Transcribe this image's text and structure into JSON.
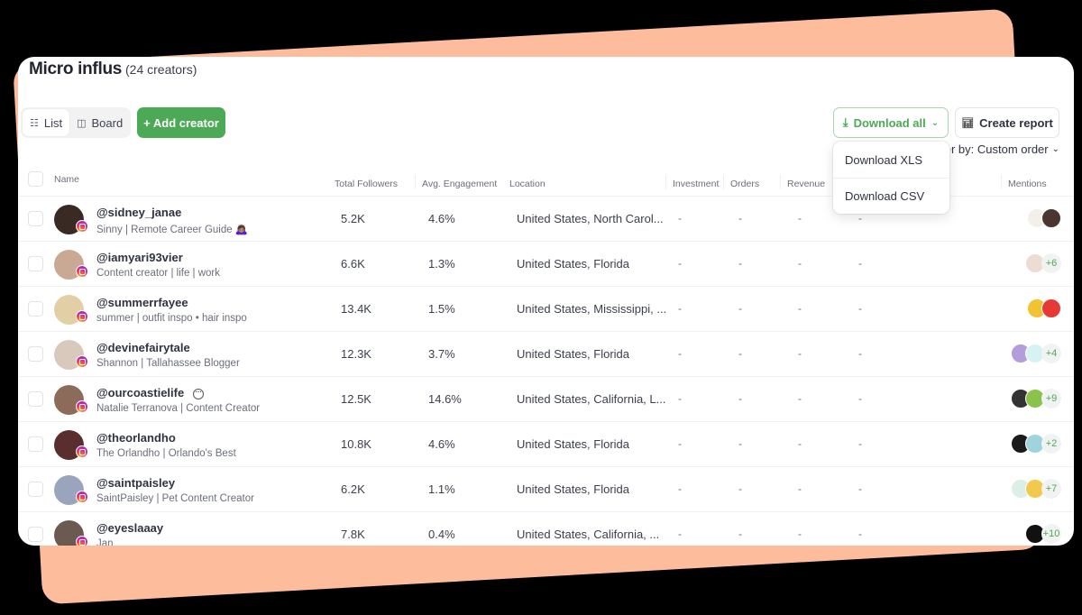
{
  "header": {
    "title": "Micro influs",
    "subtitle": "(24 creators)"
  },
  "toolbar": {
    "view_list": "List",
    "view_board": "Board",
    "add_creator": "+ Add creator",
    "download_all": "Download all",
    "create_report": "Create report",
    "order_by": "Order by: Custom order"
  },
  "dropdown": {
    "items": [
      "Download XLS",
      "Download CSV"
    ]
  },
  "table": {
    "columns": {
      "name": "Name",
      "followers": "Total Followers",
      "engagement": "Avg. Engagement",
      "location": "Location",
      "investment": "Investment",
      "orders": "Orders",
      "revenue": "Revenue",
      "mentions": "Mentions"
    },
    "rows": [
      {
        "handle": "@sidney_janae",
        "bio": "Sinny | Remote Career Guide 🙇🏽‍♀️",
        "followers": "5.2K",
        "engagement": "4.6%",
        "location": "United States, North Carol...",
        "investment": "-",
        "orders": "-",
        "revenue": "-",
        "extra": "-",
        "mentions_more": "",
        "avatar_color": "#3a2a24",
        "mention_colors": [
          "#f3efe9",
          "#4a3530"
        ]
      },
      {
        "handle": "@iamyari93vier",
        "bio": "Content creator | life | work",
        "followers": "6.6K",
        "engagement": "1.3%",
        "location": "United States, Florida",
        "investment": "-",
        "orders": "-",
        "revenue": "-",
        "extra": "-",
        "mentions_more": "+6",
        "avatar_color": "#c9a994",
        "mention_colors": [
          "#eddcd3"
        ]
      },
      {
        "handle": "@summerrfayee",
        "bio": "summer | outfit inspo • hair inspo",
        "followers": "13.4K",
        "engagement": "1.5%",
        "location": "United States, Mississippi, ...",
        "investment": "-",
        "orders": "-",
        "revenue": "-",
        "extra": "-",
        "mentions_more": "",
        "avatar_color": "#e3cfa6",
        "mention_colors": [
          "#f1c232",
          "#e53935"
        ]
      },
      {
        "handle": "@devinefairytale",
        "bio": "Shannon | Tallahassee Blogger",
        "followers": "12.3K",
        "engagement": "3.7%",
        "location": "United States, Florida",
        "investment": "-",
        "orders": "-",
        "revenue": "-",
        "extra": "-",
        "mentions_more": "+4",
        "avatar_color": "#d9c8bc",
        "mention_colors": [
          "#b39ddb",
          "#d6f3f3"
        ]
      },
      {
        "handle": "@ourcoastielife",
        "bio": "Natalie Terranova | Content Creator",
        "followers": "12.5K",
        "engagement": "14.6%",
        "location": "United States, California, L...",
        "investment": "-",
        "orders": "-",
        "revenue": "-",
        "extra": "-",
        "mentions_more": "+9",
        "avatar_color": "#8c6b5a",
        "mention_colors": [
          "#333333",
          "#8bc34a"
        ]
      },
      {
        "handle": "@theorlandho",
        "bio": "The Orlandho | Orlando's Best",
        "followers": "10.8K",
        "engagement": "4.6%",
        "location": "United States, Florida",
        "investment": "-",
        "orders": "-",
        "revenue": "-",
        "extra": "-",
        "mentions_more": "+2",
        "avatar_color": "#5a2e2e",
        "mention_colors": [
          "#1b1b1b",
          "#9fd3dd"
        ]
      },
      {
        "handle": "@saintpaisley",
        "bio": "SaintPaisley | Pet Content Creator",
        "followers": "6.2K",
        "engagement": "1.1%",
        "location": "United States, Florida",
        "investment": "-",
        "orders": "-",
        "revenue": "-",
        "extra": "-",
        "mentions_more": "+7",
        "avatar_color": "#9aa4bd",
        "mention_colors": [
          "#dcefe6",
          "#f2c94c"
        ]
      },
      {
        "handle": "@eyeslaaay",
        "bio": "Jan",
        "followers": "7.8K",
        "engagement": "0.4%",
        "location": "United States, California, ...",
        "investment": "-",
        "orders": "-",
        "revenue": "-",
        "extra": "-",
        "mentions_more": "+10",
        "avatar_color": "#6b5a52",
        "mention_colors": [
          "#ffffff",
          "#111111"
        ]
      }
    ]
  },
  "colors": {
    "accent_green": "#4caa57",
    "background_card": "#fdbc9b"
  }
}
